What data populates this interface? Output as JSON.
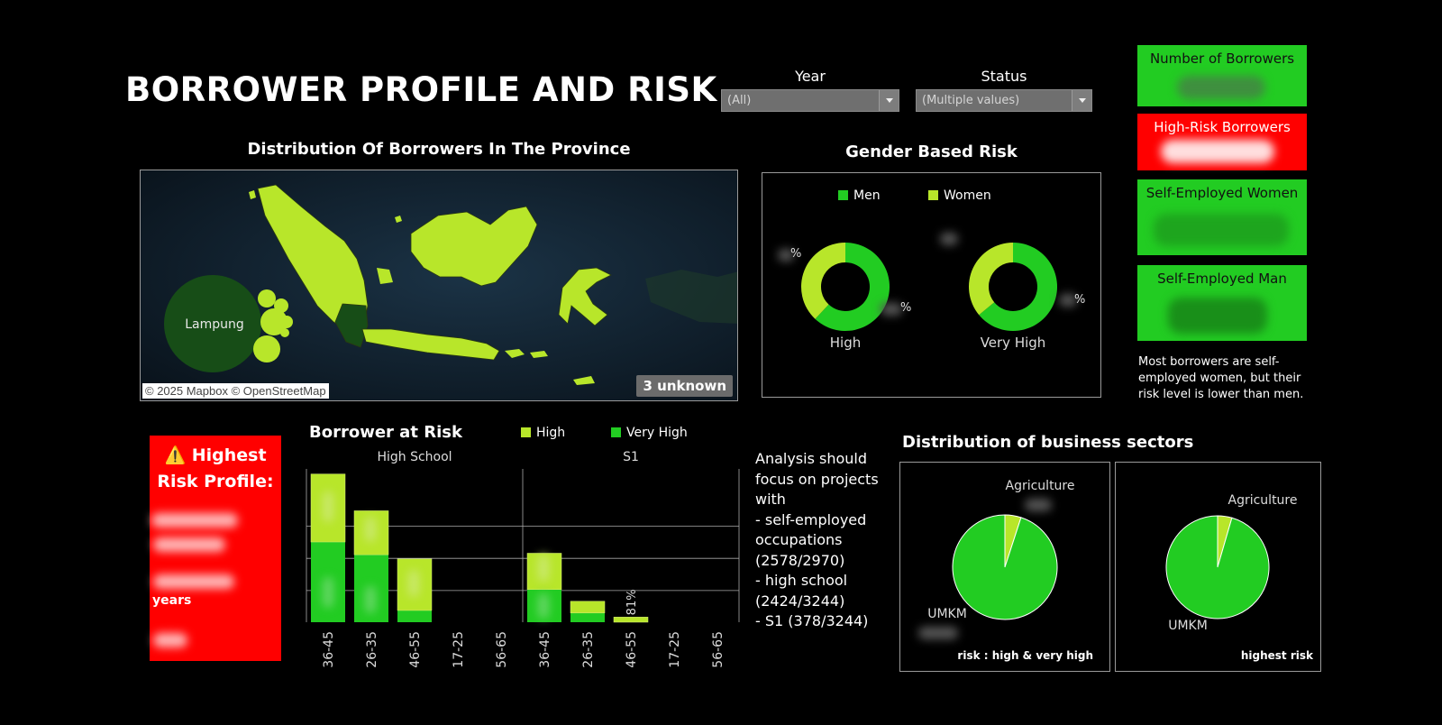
{
  "page": {
    "title": "BORROWER PROFILE AND RISK"
  },
  "filters": [
    {
      "label": "Year",
      "value": "(All)"
    },
    {
      "label": "Status",
      "value": "(Multiple values)"
    }
  ],
  "kpis": [
    {
      "label": "Number of Borrowers",
      "color": "#22cc22"
    },
    {
      "label": "High-Risk Borrowers",
      "color": "#ff0000"
    },
    {
      "label": "Self-Employed Women",
      "color": "#22cc22"
    },
    {
      "label": "Self-Employed Man",
      "color": "#22cc22"
    }
  ],
  "insight": "Most borrowers are self-employed women, but their risk level is lower than men.",
  "colors": {
    "men": "#22cc22",
    "women": "#b8e62a",
    "high": "#b8e62a",
    "very_high": "#22cc22",
    "map_land": "#b8e62a",
    "lampung": "#174d17"
  },
  "map": {
    "title": "Distribution Of Borrowers In The Province",
    "highlight_label": "Lampung",
    "credit": "© 2025 Mapbox © OpenStreetMap",
    "unknown": "3 unknown"
  },
  "gender": {
    "title": "Gender Based Risk",
    "legend": [
      "Men",
      "Women"
    ],
    "percent_suffix": "%"
  },
  "risk_profile": {
    "title_line1": "⚠️ Highest",
    "title_line2": "Risk Profile:",
    "years": "years"
  },
  "education": {
    "title": "Borrower at Risk",
    "legend": [
      "High",
      "Very High"
    ]
  },
  "analysis": {
    "lines": [
      "Analysis should",
      "focus on projects",
      "with",
      "- self-employed",
      "occupations",
      "(2578/2970)",
      "- high school",
      "(2424/3244)",
      "- S1 (378/3244)"
    ]
  },
  "sectors": {
    "title": "Distribution of business sectors",
    "captions": [
      "risk : high & very high",
      "highest risk"
    ]
  },
  "chart_data": [
    {
      "type": "pie",
      "title": "Gender Based Risk",
      "legend": [
        "Men",
        "Women"
      ],
      "charts": [
        {
          "label": "High",
          "slices": [
            {
              "name": "Men",
              "value": 62
            },
            {
              "name": "Women",
              "value": 38
            }
          ]
        },
        {
          "label": "Very High",
          "slices": [
            {
              "name": "Men",
              "value": 64
            },
            {
              "name": "Women",
              "value": 36
            }
          ]
        }
      ]
    },
    {
      "type": "bar",
      "title": "Borrower at Risk",
      "stacked": true,
      "legend": [
        "High",
        "Very High"
      ],
      "groups": [
        "High School",
        "S1"
      ],
      "categories": [
        "36-45",
        "26-35",
        "46-55",
        "17-25",
        "56-65"
      ],
      "series": [
        {
          "name": "Very High",
          "values_by_group": [
            [
              157,
              132,
              23,
              0,
              0
            ],
            [
              64,
              18,
              0,
              0,
              0
            ]
          ]
        },
        {
          "name": "High",
          "values_by_group": [
            [
              133,
              86,
              101,
              0,
              0
            ],
            [
              71,
              23,
              10,
              0,
              0
            ]
          ]
        }
      ],
      "ylim": [
        0,
        300
      ],
      "gridlines": [
        62,
        125,
        188
      ],
      "data_labels": [
        {
          "group": 1,
          "category": 2,
          "text": "81%"
        }
      ]
    },
    {
      "type": "pie",
      "title": "Distribution of business sectors",
      "charts": [
        {
          "caption": "risk : high & very high",
          "slices": [
            {
              "name": "UMKM",
              "value": 95
            },
            {
              "name": "Agriculture",
              "value": 5
            }
          ]
        },
        {
          "caption": "highest risk",
          "slices": [
            {
              "name": "UMKM",
              "value": 95.5
            },
            {
              "name": "Agriculture",
              "value": 4.5
            }
          ]
        }
      ]
    }
  ]
}
